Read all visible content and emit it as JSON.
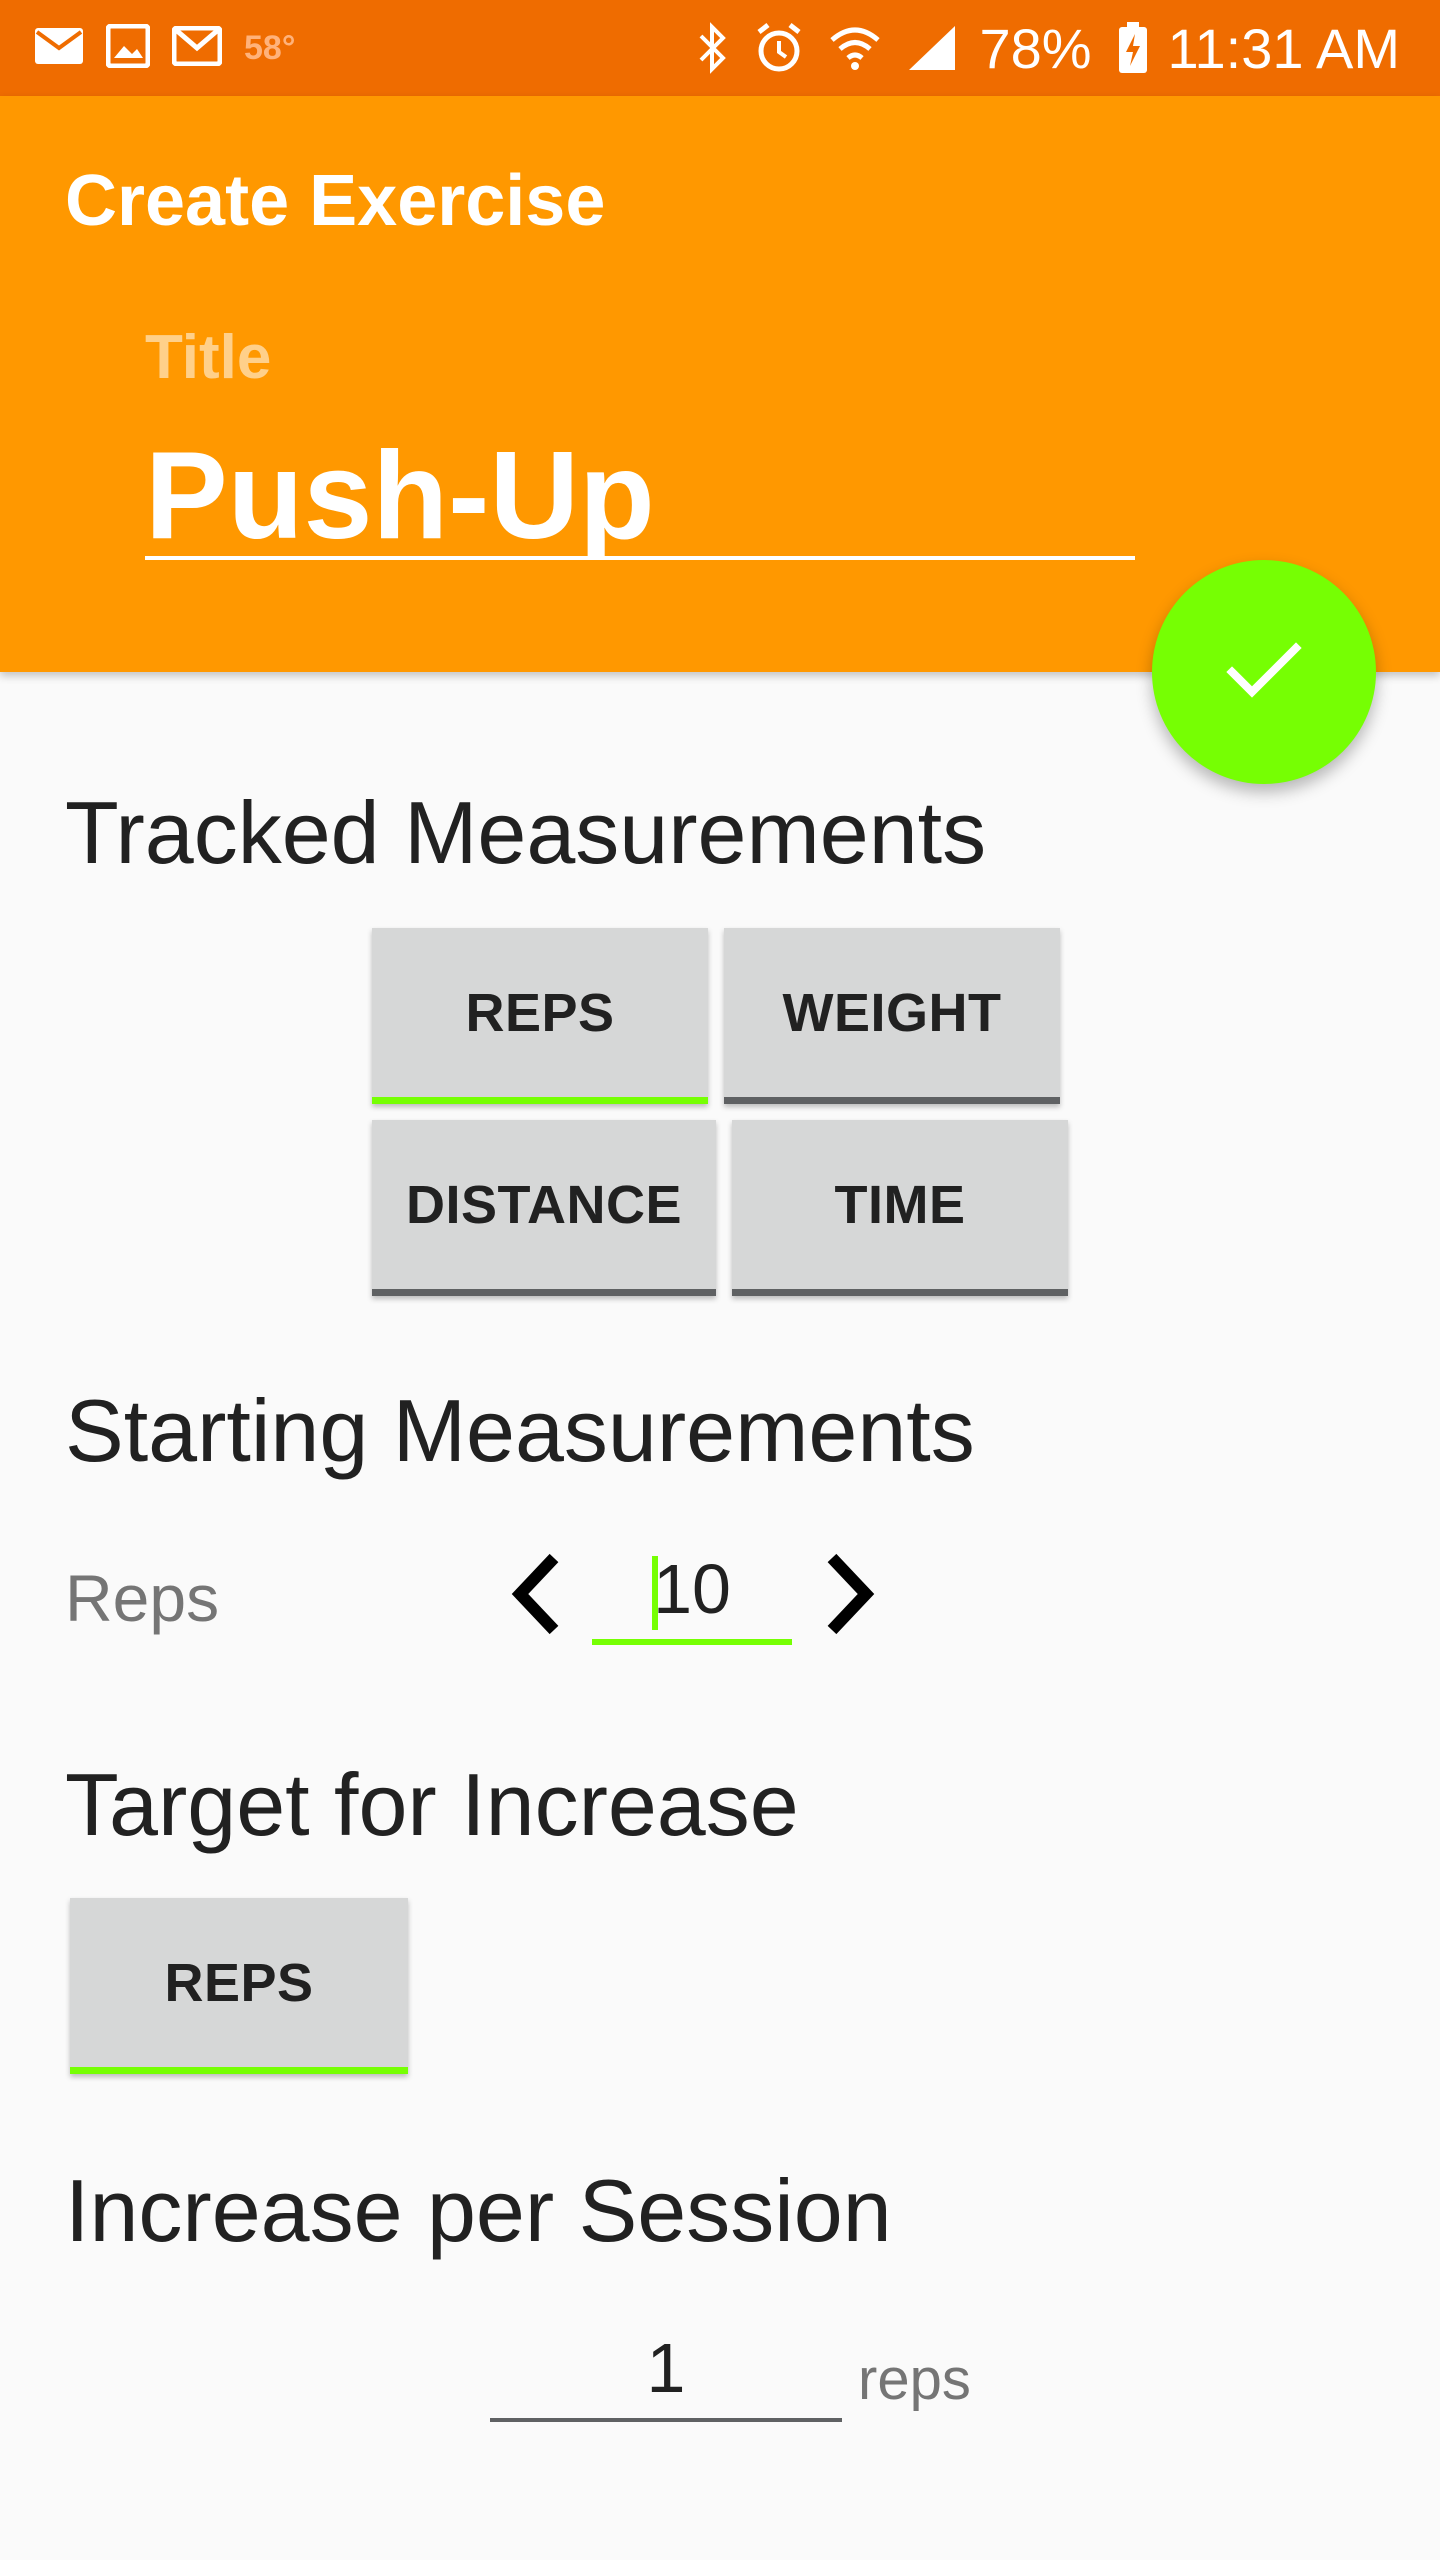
{
  "status_bar": {
    "temperature": "58°",
    "battery": "78%",
    "time": "11:31 AM",
    "left_icons": [
      "mail-icon",
      "image-icon",
      "gmail-icon"
    ],
    "right_icons": [
      "bluetooth-icon",
      "alarm-icon",
      "wifi-icon",
      "signal-icon",
      "battery-charging-icon"
    ],
    "background": "#ef6c00"
  },
  "app_bar": {
    "title": "Create Exercise",
    "title_label": "Title",
    "title_value": "Push-Up",
    "background": "#ff9800"
  },
  "fab": {
    "icon": "check-icon",
    "color": "#76ff03"
  },
  "tracked": {
    "heading": "Tracked Measurements",
    "options": [
      {
        "label": "REPS",
        "selected": true
      },
      {
        "label": "WEIGHT",
        "selected": false
      },
      {
        "label": "DISTANCE",
        "selected": false
      },
      {
        "label": "TIME",
        "selected": false
      }
    ]
  },
  "starting": {
    "heading": "Starting Measurements",
    "row_label": "Reps",
    "value": "10"
  },
  "target": {
    "heading": "Target for Increase",
    "options": [
      {
        "label": "REPS",
        "selected": true
      }
    ]
  },
  "increase": {
    "heading": "Increase per Session",
    "value": "1",
    "unit": "reps"
  },
  "colors": {
    "accent": "#76ff03",
    "toggle_bg": "#d6d7d7",
    "toggle_off_bar": "#5f6163"
  }
}
